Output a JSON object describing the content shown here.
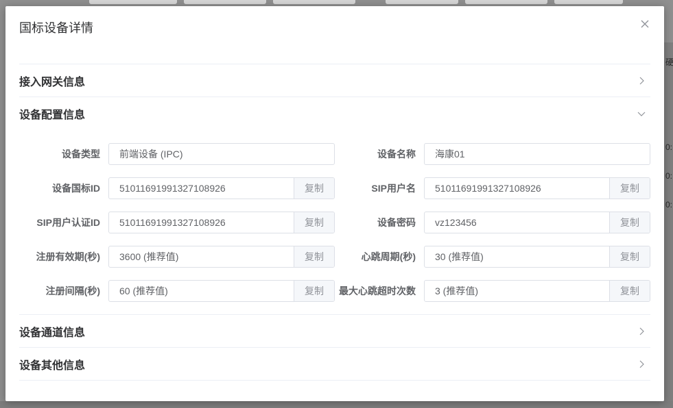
{
  "dialog": {
    "title": "国标设备详情"
  },
  "sections": {
    "gateway": {
      "title": "接入网关信息"
    },
    "config": {
      "title": "设备配置信息"
    },
    "channel": {
      "title": "设备通道信息"
    },
    "other": {
      "title": "设备其他信息"
    }
  },
  "fields": {
    "device_type": {
      "label": "设备类型",
      "value": "前端设备 (IPC)"
    },
    "device_name": {
      "label": "设备名称",
      "value": "海康01"
    },
    "gb_id": {
      "label": "设备国标ID",
      "value": "51011691991327108926"
    },
    "sip_user": {
      "label": "SIP用户名",
      "value": "51011691991327108926"
    },
    "sip_auth_id": {
      "label": "SIP用户认证ID",
      "value": "51011691991327108926"
    },
    "password": {
      "label": "设备密码",
      "value": "vz123456"
    },
    "reg_expiry": {
      "label": "注册有效期(秒)",
      "value": "3600 (推荐值)"
    },
    "heartbeat": {
      "label": "心跳周期(秒)",
      "value": "30 (推荐值)"
    },
    "reg_interval": {
      "label": "注册间隔(秒)",
      "value": "60 (推荐值)"
    },
    "max_timeout": {
      "label": "最大心跳超时次数",
      "value": "3 (推荐值)"
    }
  },
  "copy_label": "复制",
  "background": {
    "right_snippets": [
      "硬",
      "0:",
      "0:",
      "0:"
    ]
  }
}
